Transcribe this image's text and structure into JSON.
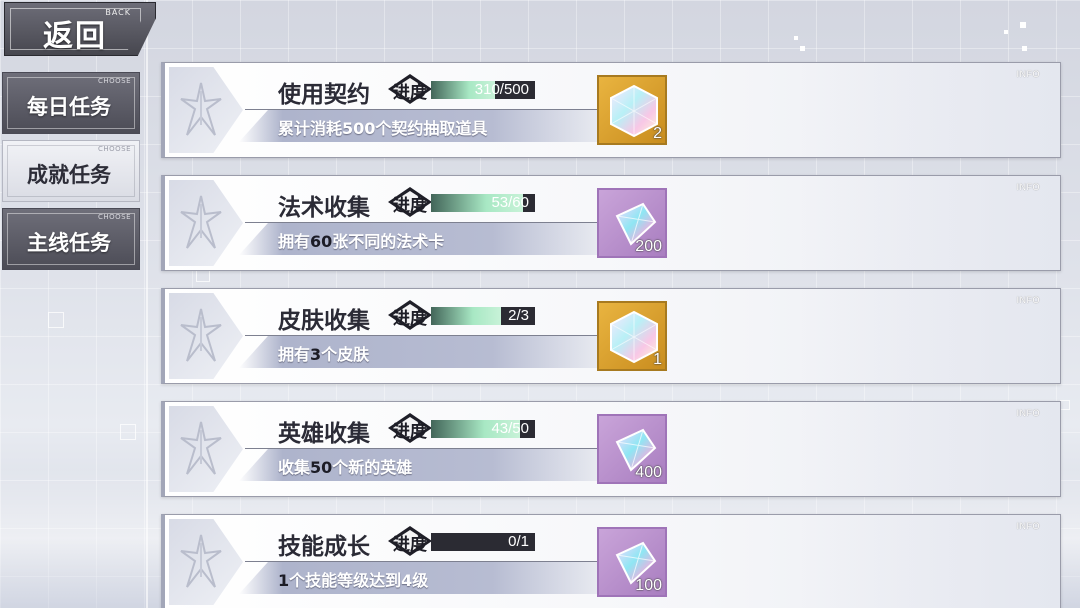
{
  "header": {
    "back_label": "返回",
    "back_sub": "BACK"
  },
  "sidebar": {
    "items": [
      {
        "label": "每日任务",
        "tag": "CHOOSE",
        "active": false
      },
      {
        "label": "成就任务",
        "tag": "CHOOSE",
        "active": true
      },
      {
        "label": "主线任务",
        "tag": "CHOOSE",
        "active": false
      }
    ]
  },
  "progress_label": "进度",
  "info_label": "INFO",
  "tasks": [
    {
      "title": "使用契约",
      "desc_pre": "累计消耗500个契约抽取道具",
      "desc_hl": "",
      "desc_post": "",
      "progress_text": "310/500",
      "progress_fraction": 0.62,
      "reward_type": "gold",
      "reward_count": "2"
    },
    {
      "title": "法术收集",
      "desc_pre": "拥有",
      "desc_hl": "60",
      "desc_post": "张不同的法术卡",
      "progress_text": "53/60",
      "progress_fraction": 0.88,
      "reward_type": "purple",
      "reward_count": "200"
    },
    {
      "title": "皮肤收集",
      "desc_pre": "拥有",
      "desc_hl": "3",
      "desc_post": "个皮肤",
      "progress_text": "2/3",
      "progress_fraction": 0.67,
      "reward_type": "gold",
      "reward_count": "1"
    },
    {
      "title": "英雄收集",
      "desc_pre": "收集",
      "desc_hl": "50",
      "desc_post": "个新的英雄",
      "progress_text": "43/50",
      "progress_fraction": 0.86,
      "reward_type": "purple",
      "reward_count": "400"
    },
    {
      "title": "技能成长",
      "desc_pre": "",
      "desc_hl": "1",
      "desc_post": "个技能等级达到4级",
      "progress_text": "0/1",
      "progress_fraction": 0.0,
      "reward_type": "purple",
      "reward_count": "100"
    }
  ],
  "colors": {
    "progress_fill": "#a8e8c4",
    "progress_track": "#2b2b33",
    "reward_gold": "#e9b440",
    "reward_purple": "#c9a4d9"
  },
  "icons": {
    "reward_gold": "hex-crystal-icon",
    "reward_purple": "diamond-gem-icon",
    "emblem": "sword-emblem-icon"
  }
}
